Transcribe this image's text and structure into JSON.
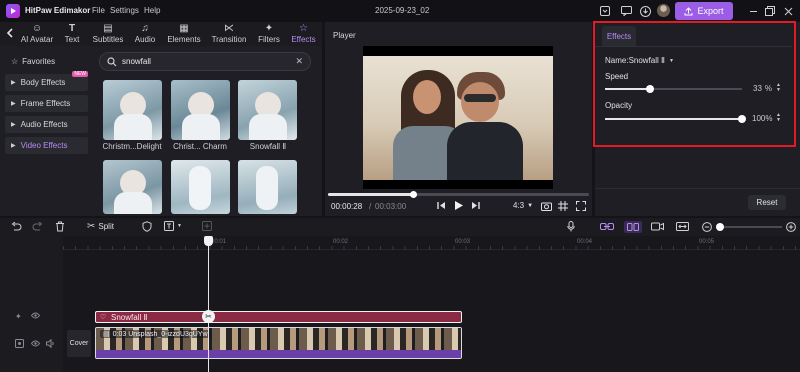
{
  "app": {
    "name": "HitPaw Edimakor",
    "menu": [
      "File",
      "Settings",
      "Help"
    ],
    "project_title": "2025-09-23_02",
    "export_label": "Export"
  },
  "toolbar": {
    "back_icon": "chevron-left-icon",
    "tools": [
      {
        "label": "AI Avatar",
        "icon": "ai-avatar-icon"
      },
      {
        "label": "Text",
        "icon": "text-icon"
      },
      {
        "label": "Subtitles",
        "icon": "subtitles-icon"
      },
      {
        "label": "Audio",
        "icon": "music-note-icon"
      },
      {
        "label": "Elements",
        "icon": "elements-icon"
      },
      {
        "label": "Transition",
        "icon": "transition-icon"
      },
      {
        "label": "Filters",
        "icon": "filters-icon"
      },
      {
        "label": "Effects",
        "icon": "effects-icon"
      }
    ],
    "active_tool": "Effects"
  },
  "sidebar": {
    "favorites": "Favorites",
    "items": [
      {
        "label": "Body Effects",
        "badge": "NEW"
      },
      {
        "label": "Frame Effects"
      },
      {
        "label": "Audio Effects"
      },
      {
        "label": "Video Effects"
      }
    ],
    "active_item": "Video Effects"
  },
  "search": {
    "value": "snowfall"
  },
  "effects_grid": {
    "items": [
      {
        "label": "Christm...Delight"
      },
      {
        "label": "Christ... Charm"
      },
      {
        "label": "Snowfall Ⅱ"
      },
      {
        "label": ""
      },
      {
        "label": ""
      },
      {
        "label": ""
      }
    ]
  },
  "player": {
    "title": "Player",
    "current_time": "00:00:28",
    "separator": "/",
    "total_time": "00:03:00",
    "aspect_ratio": "4:3",
    "progress": 0.33
  },
  "right_panel": {
    "tab": "Effects",
    "name_label": "Name:Snowfall Ⅱ",
    "speed_label": "Speed",
    "speed_value": "33",
    "speed_unit": "%",
    "speed_fraction": 0.33,
    "opacity_label": "Opacity",
    "opacity_value": "100%",
    "opacity_fraction": 1.0,
    "reset_label": "Reset"
  },
  "timeline": {
    "split_label": "Split",
    "ruler": [
      "00:01",
      "00:02",
      "00:03",
      "00:04",
      "00:05"
    ],
    "effect_clip_label": "Snowfall Ⅱ",
    "video_clip_label": "0:03  Unsplash_0-izzdU3gUYw",
    "cover_label": "Cover"
  },
  "colors": {
    "accent": "#9b5de5",
    "effect_clip": "#8a2a45",
    "audio_bar": "#6b3fa8",
    "highlight_border": "#e21b26"
  }
}
